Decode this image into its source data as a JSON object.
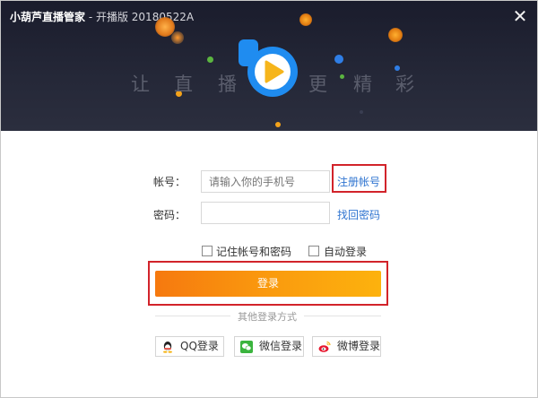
{
  "window": {
    "title_main": "小葫芦直播管家",
    "title_sub": " - 开播版 20180522A",
    "close_symbol": "✕"
  },
  "banner": {
    "slogan_chars": [
      "让",
      "直",
      "播",
      "更",
      "精",
      "彩"
    ]
  },
  "form": {
    "account_label": "帐号：",
    "account_placeholder": "请输入你的手机号",
    "register_link": "注册帐号",
    "password_label": "密码：",
    "password_value": "",
    "forgot_link": "找回密码",
    "remember_label": "记住帐号和密码",
    "remember_checked": false,
    "auto_login_label": "自动登录",
    "auto_login_checked": false,
    "login_button": "登录"
  },
  "other_login": {
    "heading": "其他登录方式",
    "options": [
      {
        "label": "QQ登录",
        "icon": "qq-icon"
      },
      {
        "label": "微信登录",
        "icon": "wechat-icon"
      },
      {
        "label": "微博登录",
        "icon": "weibo-icon"
      }
    ]
  },
  "colors": {
    "header_bg": "#252838",
    "accent_orange": "#f6790f",
    "link_blue": "#2f74d0",
    "highlight_red": "#d2232a",
    "logo_blue": "#1f8cf0",
    "play_yellow": "#f6b51b"
  }
}
